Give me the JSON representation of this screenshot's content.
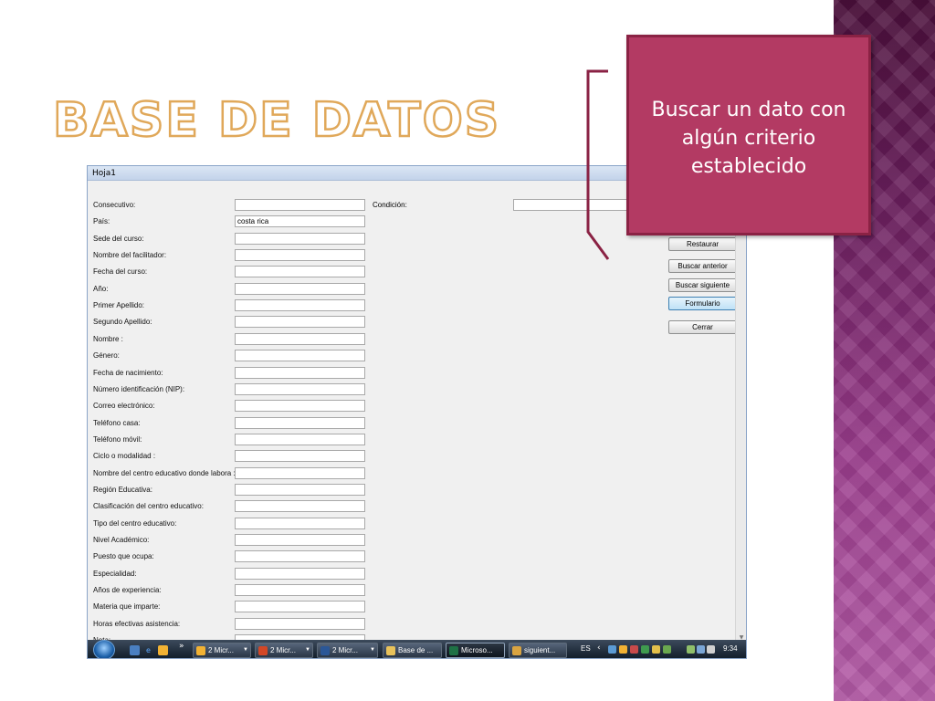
{
  "slide": {
    "title": "BASE DE DATOS",
    "callout_text": "Buscar un dato con algún criterio establecido"
  },
  "window": {
    "title": "Hoja1",
    "condition_label": "Condición:",
    "fields": [
      {
        "label": "Consecutivo:",
        "value": ""
      },
      {
        "label": "País:",
        "value": "costa rica"
      },
      {
        "label": "Sede del curso:",
        "value": ""
      },
      {
        "label": "Nombre del facilitador:",
        "value": ""
      },
      {
        "label": "Fecha del curso:",
        "value": ""
      },
      {
        "label": "Año:",
        "value": ""
      },
      {
        "label": "Primer Apellido:",
        "value": ""
      },
      {
        "label": "Segundo Apellido:",
        "value": ""
      },
      {
        "label": "Nombre :",
        "value": ""
      },
      {
        "label": "Género:",
        "value": ""
      },
      {
        "label": "Fecha de nacimiento:",
        "value": ""
      },
      {
        "label": "Número identificación (NIP):",
        "value": ""
      },
      {
        "label": "Correo electrónico:",
        "value": ""
      },
      {
        "label": "Teléfono casa:",
        "value": ""
      },
      {
        "label": "Teléfono móvil:",
        "value": ""
      },
      {
        "label": "Ciclo o modalidad :",
        "value": ""
      },
      {
        "label": "Nombre del centro educativo donde labora :",
        "value": ""
      },
      {
        "label": "Región Educativa:",
        "value": ""
      },
      {
        "label": "Clasificación del centro educativo:",
        "value": ""
      },
      {
        "label": "Tipo del centro educativo:",
        "value": ""
      },
      {
        "label": "Nivel Académico:",
        "value": ""
      },
      {
        "label": "Puesto que ocupa:",
        "value": ""
      },
      {
        "label": "Especialidad:",
        "value": ""
      },
      {
        "label": "Años de experiencia:",
        "value": ""
      },
      {
        "label": "Materia que imparte:",
        "value": ""
      },
      {
        "label": "Horas efectivas asistencia:",
        "value": ""
      },
      {
        "label": "Nota:",
        "value": ""
      }
    ],
    "buttons": {
      "restaurar": "Restaurar",
      "buscar_anterior": "Buscar anterior",
      "buscar_siguiente": "Buscar siguiente",
      "formulario": "Formulario",
      "cerrar": "Cerrar"
    }
  },
  "taskbar": {
    "overflow": "»",
    "items": [
      {
        "label": "2 Micr...",
        "icon": "outlook-icon",
        "color": "#f2b233"
      },
      {
        "label": "2 Micr...",
        "icon": "powerpoint-icon",
        "color": "#d24726"
      },
      {
        "label": "2 Micr...",
        "icon": "word-icon",
        "color": "#2b5797"
      },
      {
        "label": "Base de ...",
        "icon": "folder-icon",
        "color": "#e8c25a"
      },
      {
        "label": "Microso...",
        "icon": "excel-icon",
        "color": "#1e7145"
      },
      {
        "label": "siguient...",
        "icon": "paint-icon",
        "color": "#d9a441"
      }
    ],
    "language": "ES",
    "clock": "9:34"
  },
  "colors": {
    "callout_bg": "#b33a63",
    "title_outline": "#e0a85a",
    "side_band": "#8a3080"
  }
}
